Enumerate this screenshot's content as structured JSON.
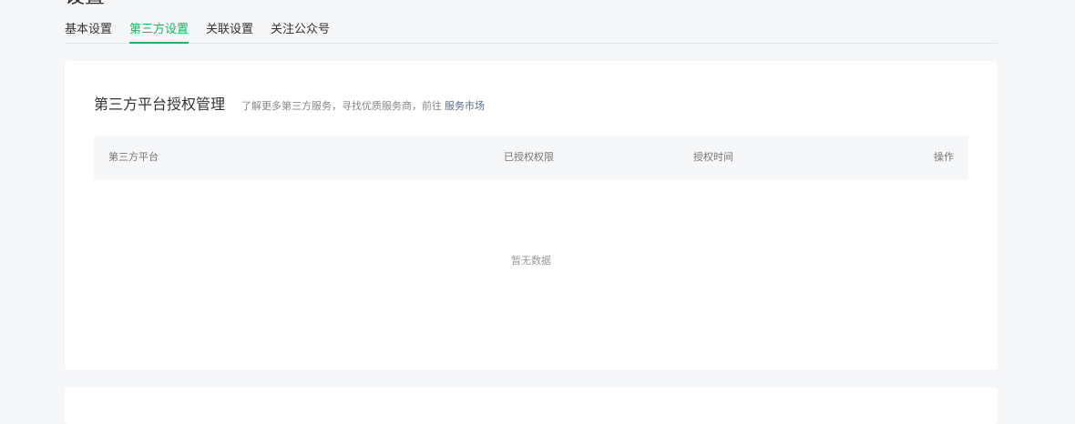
{
  "page": {
    "title": "设置"
  },
  "tabs": [
    {
      "label": "基本设置",
      "active": false
    },
    {
      "label": "第三方设置",
      "active": true
    },
    {
      "label": "关联设置",
      "active": false
    },
    {
      "label": "关注公众号",
      "active": false
    }
  ],
  "auth_section": {
    "title": "第三方平台授权管理",
    "description": "了解更多第三方服务，寻找优质服务商，前往",
    "link_label": "服务市场",
    "columns": [
      "第三方平台",
      "已授权权限",
      "授权时间",
      "操作"
    ],
    "empty_text": "暂无数据"
  },
  "colors": {
    "accent": "#07c160",
    "link": "#576b95",
    "background": "#f6f7f9"
  }
}
